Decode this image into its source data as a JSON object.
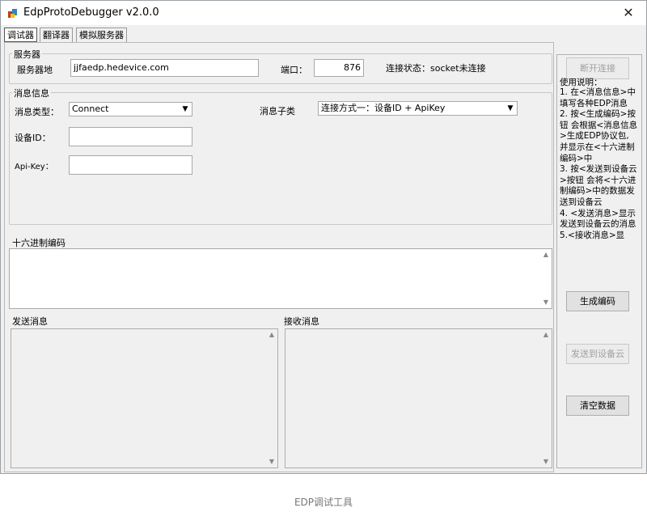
{
  "window": {
    "title": "EdpProtoDebugger v2.0.0"
  },
  "tabs": [
    {
      "label": "调试器"
    },
    {
      "label": "翻译器"
    },
    {
      "label": "模拟服务器"
    }
  ],
  "server": {
    "group_label": "服务器",
    "address_label": "服务器地",
    "address_value": "jjfaedp.hedevice.com",
    "port_label": "端口：",
    "port_value": "876",
    "status_text": "连接状态：socket未连接",
    "disconnect_button": "断开连接"
  },
  "message": {
    "group_label": "消息信息",
    "type_label": "消息类型：",
    "type_value": "Connect",
    "subtype_label": "消息子类",
    "subtype_value": "连接方式一：设备ID + ApiKey",
    "device_id_label": "设备ID：",
    "device_id_value": "",
    "apikey_label": "Api-Key：",
    "apikey_value": ""
  },
  "hex": {
    "label": "十六进制编码",
    "value": ""
  },
  "send": {
    "label": "发送消息",
    "value": ""
  },
  "receive": {
    "label": "接收消息",
    "value": ""
  },
  "help": {
    "title": "使用说明：",
    "text": "1. 在<消息信息>中填写各种EDP消息\n2. 按<生成编码>按钮 会根据<消息信息>生成EDP协议包, 并显示在<十六进制编码>中\n3. 按<发送到设备云>按钮 会将<十六进制编码>中的数据发送到设备云\n4. <发送消息>显示发送到设备云的消息\n5.<接收消息>显"
  },
  "buttons": {
    "generate": "生成编码",
    "send_cloud": "发送到设备云",
    "clear": "清空数据"
  },
  "caption": "EDP调试工具"
}
